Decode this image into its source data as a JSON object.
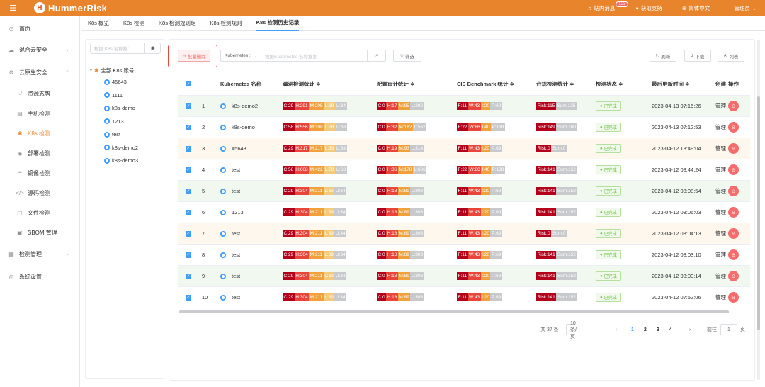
{
  "app": {
    "name": "HummerRisk",
    "logo_letter": "H"
  },
  "topbar": {
    "messages": "站内消息",
    "msg_count": "123",
    "support": "获取支持",
    "language": "简体中文",
    "user": "管理员"
  },
  "sidebar": {
    "items": [
      {
        "label": "首页",
        "icon": "clock-icon",
        "level": 1
      },
      {
        "label": "混合云安全",
        "icon": "cloud-icon",
        "level": 1,
        "arrow": "⌄"
      },
      {
        "label": "云原生安全",
        "icon": "cloud-native-icon",
        "level": 1,
        "arrow": "⌃"
      },
      {
        "label": "资源态势",
        "icon": "shield-icon",
        "level": 2
      },
      {
        "label": "主机检测",
        "icon": "host-icon",
        "level": 2
      },
      {
        "label": "K8s 检测",
        "icon": "k8s-icon",
        "level": 2,
        "active": true
      },
      {
        "label": "部署检测",
        "icon": "deploy-icon",
        "level": 2
      },
      {
        "label": "镜像检测",
        "icon": "image-icon",
        "level": 2
      },
      {
        "label": "源码检测",
        "icon": "code-icon",
        "level": 2
      },
      {
        "label": "文件检测",
        "icon": "file-icon",
        "level": 2
      },
      {
        "label": "SBOM 管理",
        "icon": "sbom-icon",
        "level": 2
      },
      {
        "label": "检测管理",
        "icon": "grid-icon",
        "level": 1,
        "arrow": "⌄"
      },
      {
        "label": "系统设置",
        "icon": "settings-icon",
        "level": 1
      }
    ]
  },
  "tabs": [
    {
      "label": "K8s 概览"
    },
    {
      "label": "K8s 检测"
    },
    {
      "label": "K8s 检测规则组"
    },
    {
      "label": "K8s 检测规则"
    },
    {
      "label": "K8s 检测历史记录",
      "active": true
    }
  ],
  "tree": {
    "search_placeholder": "根据 K8s 名称搜:",
    "root": "全部 K8s 账号",
    "nodes": [
      "45643",
      "1111",
      "k8s-demo",
      "1213",
      "test",
      "k8s-demo2",
      "k8s-demo3"
    ]
  },
  "toolbar": {
    "batch_delete": "批量删除",
    "select_value": "Kubernetes :",
    "search_placeholder": "根据Kubernetes 名称搜索",
    "filter": "筛选",
    "refresh": "刷新",
    "download": "下载",
    "columns": "列表"
  },
  "table": {
    "headers": [
      "",
      "",
      "Kubernetes 名称",
      "漏洞检测统计 ≑",
      "配置审计统计 ≑",
      "CIS Benchmark 统计 ≑",
      "合规检测统计 ≑",
      "检测状态 ≑",
      "最后更新时间 ≑",
      "创建",
      "操作"
    ],
    "rows": [
      {
        "idx": "1",
        "name": "k8s-demo2",
        "bg": "green",
        "vuln": [
          "C:29",
          "H:291",
          "M:205",
          "L:39",
          "U:34"
        ],
        "cfg": [
          "C:0",
          "H:17",
          "M:85",
          "L:292"
        ],
        "cis": [
          "F:11",
          "W:43",
          "I:20",
          "P:69"
        ],
        "risk": [
          "Risk:115",
          "Sum:125"
        ],
        "status": "已完成",
        "time": "2023-04-13 07:15:26",
        "creator": "管理"
      },
      {
        "idx": "2",
        "name": "k8s-demo",
        "bg": "white",
        "vuln": [
          "C:58",
          "H:556",
          "M:398",
          "L:78",
          "U:68"
        ],
        "cfg": [
          "C:0",
          "H:32",
          "M:162",
          "L:562"
        ],
        "cis": [
          "F:22",
          "W:86",
          "I:40",
          "P:138"
        ],
        "risk": [
          "Risk:149",
          "Sum:160"
        ],
        "status": "已完成",
        "time": "2023-04-13 07:12:53",
        "creator": "管理"
      },
      {
        "idx": "3",
        "name": "45643",
        "bg": "yellow",
        "vuln": [
          "C:29",
          "H:317",
          "M:217",
          "L:39",
          "U:34"
        ],
        "cfg": [
          "C:0",
          "H:19",
          "M:93",
          "L:314"
        ],
        "cis": [
          "F:11",
          "W:43",
          "I:20",
          "P:69"
        ],
        "risk": [
          "Risk:0",
          "Sum:0"
        ],
        "status": "已完成",
        "time": "2023-04-12 18:49:04",
        "creator": "管理"
      },
      {
        "idx": "4",
        "name": "test",
        "bg": "white",
        "vuln": [
          "C:58",
          "H:608",
          "M:422",
          "L:78",
          "U:68"
        ],
        "cfg": [
          "C:0",
          "H:36",
          "M:178",
          "L:606"
        ],
        "cis": [
          "F:22",
          "W:86",
          "I:40",
          "P:138"
        ],
        "risk": [
          "Risk:141",
          "Sum:152"
        ],
        "status": "已完成",
        "time": "2023-04-12 08:44:24",
        "creator": "管理"
      },
      {
        "idx": "5",
        "name": "test",
        "bg": "green",
        "vuln": [
          "C:29",
          "H:304",
          "M:211",
          "L:39",
          "U:34"
        ],
        "cfg": [
          "C:0",
          "H:18",
          "M:89",
          "L:303"
        ],
        "cis": [
          "F:11",
          "W:43",
          "I:20",
          "P:69"
        ],
        "risk": [
          "Risk:141",
          "Sum:152"
        ],
        "status": "已完成",
        "time": "2023-04-12 08:08:54",
        "creator": "管理"
      },
      {
        "idx": "6",
        "name": "1213",
        "bg": "white",
        "vuln": [
          "C:29",
          "H:304",
          "M:211",
          "L:39",
          "U:34"
        ],
        "cfg": [
          "C:0",
          "H:18",
          "M:89",
          "L:303"
        ],
        "cis": [
          "F:11",
          "W:43",
          "I:20",
          "P:69"
        ],
        "risk": [
          "Risk:141",
          "Sum:152"
        ],
        "status": "已完成",
        "time": "2023-04-12 08:06:03",
        "creator": "管理"
      },
      {
        "idx": "7",
        "name": "test",
        "bg": "yellow",
        "vuln": [
          "C:29",
          "H:304",
          "M:211",
          "L:39",
          "U:34"
        ],
        "cfg": [
          "C:0",
          "H:18",
          "M:89",
          "L:303"
        ],
        "cis": [
          "F:11",
          "W:43",
          "I:20",
          "P:69"
        ],
        "risk": [
          "Risk:0",
          "Sum:0"
        ],
        "status": "已完成",
        "time": "2023-04-12 08:04:13",
        "creator": "管理"
      },
      {
        "idx": "8",
        "name": "test",
        "bg": "white",
        "vuln": [
          "C:29",
          "H:304",
          "M:211",
          "L:39",
          "U:34"
        ],
        "cfg": [
          "C:0",
          "H:18",
          "M:89",
          "L:303"
        ],
        "cis": [
          "F:11",
          "W:43",
          "I:20",
          "P:69"
        ],
        "risk": [
          "Risk:141",
          "Sum:152"
        ],
        "status": "已完成",
        "time": "2023-04-12 08:03:10",
        "creator": "管理"
      },
      {
        "idx": "9",
        "name": "test",
        "bg": "green",
        "vuln": [
          "C:29",
          "H:304",
          "M:211",
          "L:39",
          "U:34"
        ],
        "cfg": [
          "C:0",
          "H:18",
          "M:89",
          "L:303"
        ],
        "cis": [
          "F:11",
          "W:43",
          "I:20",
          "P:69"
        ],
        "risk": [
          "Risk:141",
          "Sum:152"
        ],
        "status": "已完成",
        "time": "2023-04-12 08:00:14",
        "creator": "管理"
      },
      {
        "idx": "10",
        "name": "test",
        "bg": "white",
        "vuln": [
          "C:29",
          "H:304",
          "M:211",
          "L:39",
          "U:34"
        ],
        "cfg": [
          "C:0",
          "H:18",
          "M:89",
          "L:303"
        ],
        "cis": [
          "F:11",
          "W:43",
          "I:20",
          "P:69"
        ],
        "risk": [
          "Risk:141",
          "Sum:152"
        ],
        "status": "已完成",
        "time": "2023-04-12 07:52:06",
        "creator": "管理"
      }
    ]
  },
  "pagination": {
    "total": "共 37 条",
    "page_size": "10条/页",
    "pages": [
      "1",
      "2",
      "3",
      "4"
    ],
    "current": "1",
    "goto_label": "前往",
    "goto_value": "1",
    "page_unit": "页"
  },
  "colors": {
    "accent": "#e8842c",
    "vuln": [
      "#b3001b",
      "#e8463a",
      "#f0a13c",
      "#f3c97a",
      "#c8c9cc"
    ],
    "cfg": [
      "#b3001b",
      "#e8463a",
      "#f0a13c",
      "#c8c9cc"
    ],
    "cis": [
      "#b3001b",
      "#e8463a",
      "#f0a13c",
      "#c8c9cc"
    ],
    "risk": [
      "#b3001b",
      "#c8c9cc"
    ]
  }
}
